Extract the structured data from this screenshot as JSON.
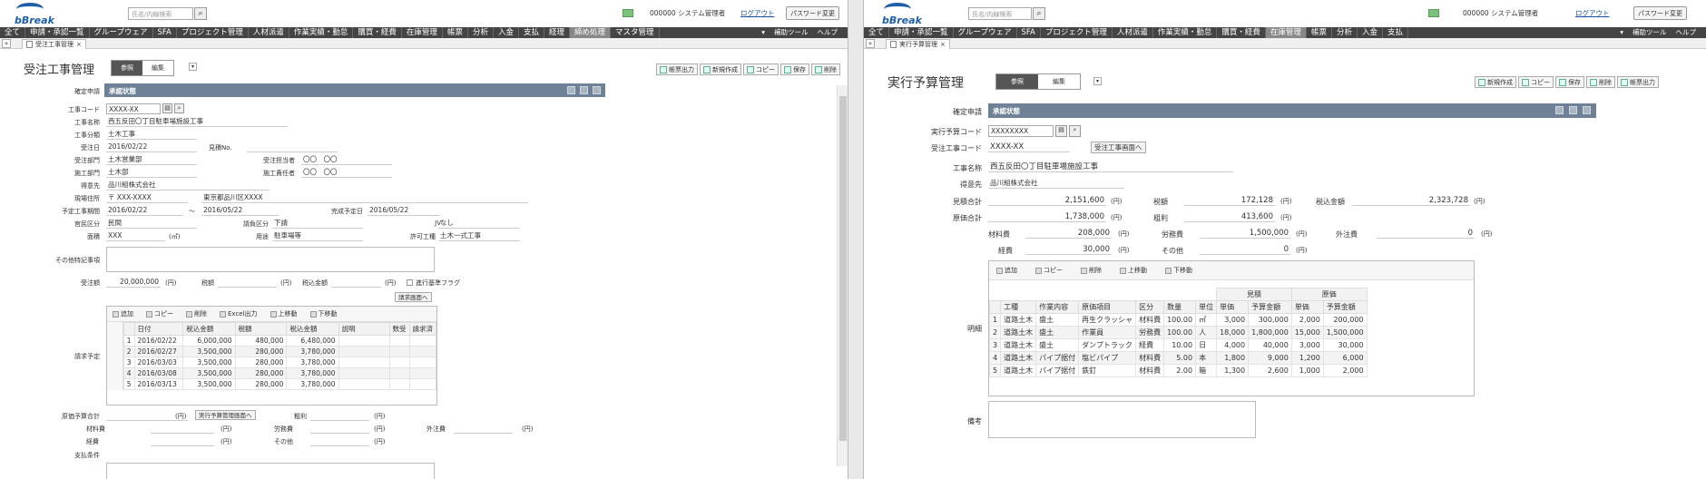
{
  "header": {
    "search_placeholder": "氏名/内線検索",
    "user": "000000 システム管理者",
    "logout": "ログアウト",
    "password_change": "パスワード変更"
  },
  "nav_left": [
    "全て",
    "申請・承認一覧",
    "グループウェア",
    "SFA",
    "プロジェクト管理",
    "人材派遣",
    "作業実績・勤怠",
    "購買・経費",
    "在庫管理",
    "帳票",
    "分析",
    "入金",
    "支払",
    "経理",
    "締め処理",
    "マスタ管理"
  ],
  "nav_left_active": "締め処理",
  "nav_right": [
    "▾",
    "補助ツール",
    "ヘルプ"
  ],
  "nav_right_b": [
    "▾",
    "補助ツール",
    "ヘルプ"
  ],
  "nav_b": [
    "全て",
    "申請・承認一覧",
    "グループウェア",
    "SFA",
    "プロジェクト管理",
    "人材派遣",
    "作業実績・勤怠",
    "購買・経費",
    "在庫管理",
    "帳票",
    "分析",
    "入金",
    "支払"
  ],
  "nav_b_active": "在庫管理",
  "left": {
    "tab": "受注工事管理",
    "title": "受注工事管理",
    "mode_ref": "参照",
    "mode_edit": "編集",
    "buttons": [
      "帳票出力",
      "新規作成",
      "コピー",
      "保存",
      "削除"
    ],
    "bar": "承認状態",
    "labels": {
      "kakutei": "確定申請",
      "code": "工事コード",
      "name": "工事名称",
      "bunrui": "工事分類",
      "date": "受注日",
      "mitsumori": "見積No.",
      "bumon": "受注部門",
      "tanto": "受注担当者",
      "seko": "施工部門",
      "sekinin": "施工責任者",
      "tokui": "得意先",
      "genba": "現場住所",
      "period": "予定工事期間",
      "kanryo": "完成予定日",
      "kanko": "官民区分",
      "keiyaku": "請負区分",
      "jv": "JV",
      "menseki": "面積",
      "yoto": "用途",
      "kyoka": "許可工種",
      "other": "その他特記事項",
      "amount": "受注額",
      "tax": "税額",
      "total": "税込金額",
      "flag": "進行基準フラグ",
      "plan": "請求予定",
      "genka": "原価予算合計",
      "arari": "粗利",
      "zairyo": "材料費",
      "romu": "労務費",
      "gaichu": "外注費",
      "keihi": "経費",
      "sonota": "その他",
      "shiharai": "支払条件"
    },
    "values": {
      "code": "XXXX-XX",
      "name": "西五反田〇丁目駐車場施設工事",
      "bunrui": "土木工事",
      "date": "2016/02/22",
      "bumon": "土木営業部",
      "tanto": "〇〇　〇〇",
      "seko": "土木部",
      "sekinin": "〇〇　〇〇",
      "tokui": "品川組株式会社",
      "zip": "〒 XXX-XXXX",
      "addr": "東京都品川区XXXX",
      "start": "2016/02/22",
      "tilde": "～",
      "end": "2016/05/22",
      "kanryo": "2016/05/22",
      "kanko": "民間",
      "keiyaku": "下請",
      "jv": "なし",
      "menseki": "XXX",
      "menseki_unit": "(㎡)",
      "yoto": "駐車場等",
      "kyoka": "土木一式工事",
      "amount": "20,000,000",
      "yen": "(円)",
      "seikyu_btn": "請求画面へ",
      "genka_btn": "実行予算管理画面へ"
    },
    "grid_tools": [
      "追加",
      "コピー",
      "削除",
      "Excel出力",
      "上移動",
      "下移動"
    ],
    "grid_cols": [
      "",
      "日付",
      "税込金額",
      "税額",
      "税込金額",
      "説明",
      "数受",
      "請求済"
    ],
    "grid_rows": [
      [
        "1",
        "2016/02/22",
        "6,000,000",
        "480,000",
        "6,480,000"
      ],
      [
        "2",
        "2016/02/27",
        "3,500,000",
        "280,000",
        "3,780,000"
      ],
      [
        "3",
        "2016/03/03",
        "3,500,000",
        "280,000",
        "3,780,000"
      ],
      [
        "4",
        "2016/03/08",
        "3,500,000",
        "280,000",
        "3,780,000"
      ],
      [
        "5",
        "2016/03/13",
        "3,500,000",
        "280,000",
        "3,780,000"
      ]
    ]
  },
  "right": {
    "tab": "実行予算管理",
    "title": "実行予算管理",
    "mode_ref": "参照",
    "mode_edit": "編集",
    "buttons": [
      "新規作成",
      "コピー",
      "保存",
      "削除",
      "帳票出力"
    ],
    "bar": "承認状態",
    "labels": {
      "kakutei": "確定申請",
      "code": "実行予算コード",
      "order": "受注工事コード",
      "name": "工事名称",
      "tokui": "得意先",
      "mitsumori": "見積合計",
      "genka": "原価合計",
      "tax": "税額",
      "arari": "粗利",
      "total": "税込金額",
      "zairyo": "材料費",
      "romu": "労務費",
      "gaichu": "外注費",
      "keihi": "経費",
      "sonota": "その他",
      "meisai": "明細",
      "biko": "備考"
    },
    "values": {
      "code": "XXXXXXXX",
      "order": "XXXX-XX",
      "order_btn": "受注工事画面へ",
      "name": "西五反田〇丁目駐車場施設工事",
      "tokui": "品川組株式会社",
      "mitsumori": "2,151,600",
      "genka": "1,738,000",
      "tax": "172,128",
      "arari": "413,600",
      "total": "2,323,728",
      "zairyo": "208,000",
      "romu": "1,500,000",
      "gaichu": "0",
      "keihi": "30,000",
      "sonota": "0",
      "yen": "(円)"
    },
    "grid_tools": [
      "追加",
      "コピー",
      "削除",
      "上移動",
      "下移動"
    ],
    "group_headers": [
      "見積",
      "原価"
    ],
    "grid_cols": [
      "",
      "工種",
      "作業内容",
      "原価項目",
      "区分",
      "数量",
      "単位",
      "単価",
      "予算金額",
      "単価",
      "予算金額"
    ],
    "grid_rows": [
      [
        "1",
        "道路土木",
        "盛土",
        "再生クラッシャ",
        "材料費",
        "100.00",
        "㎥",
        "3,000",
        "300,000",
        "2,000",
        "200,000"
      ],
      [
        "2",
        "道路土木",
        "盛土",
        "作業員",
        "労務費",
        "100.00",
        "人",
        "18,000",
        "1,800,000",
        "15,000",
        "1,500,000"
      ],
      [
        "3",
        "道路土木",
        "盛土",
        "ダンプトラック",
        "経費",
        "10.00",
        "日",
        "4,000",
        "40,000",
        "3,000",
        "30,000"
      ],
      [
        "4",
        "道路土木",
        "パイプ据付",
        "塩ビパイプ",
        "材料費",
        "5.00",
        "本",
        "1,800",
        "9,000",
        "1,200",
        "6,000"
      ],
      [
        "5",
        "道路土木",
        "パイプ据付",
        "鉄釘",
        "材料費",
        "2.00",
        "箱",
        "1,300",
        "2,600",
        "1,000",
        "2,000"
      ]
    ]
  }
}
